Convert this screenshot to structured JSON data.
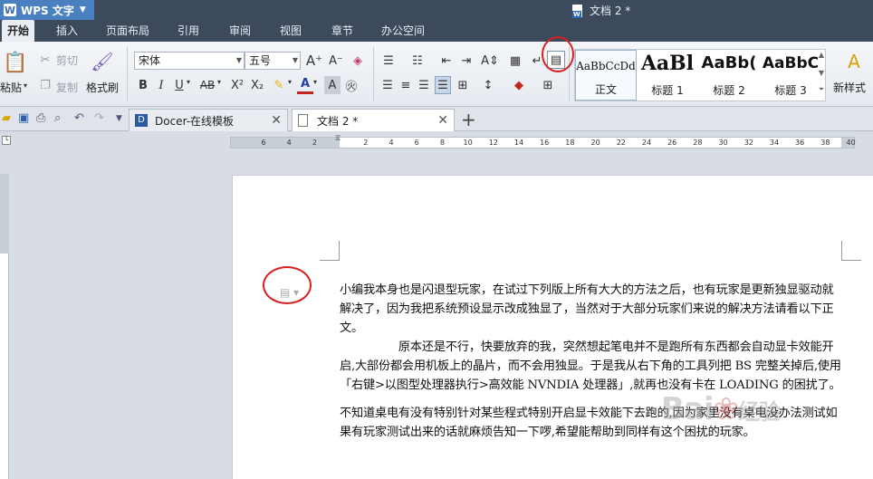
{
  "titlebar": {
    "app_name": "WPS 文字",
    "doc_title": "文档 2 *"
  },
  "menu": {
    "tabs": [
      "开始",
      "插入",
      "页面布局",
      "引用",
      "审阅",
      "视图",
      "章节",
      "办公空间"
    ]
  },
  "ribbon": {
    "paste": "粘贴",
    "cut": "剪切",
    "copy": "复制",
    "format_painter": "格式刷",
    "font_name": "宋体",
    "font_size": "五号",
    "styles": [
      {
        "sample": "AaBbCcDd",
        "name": "正文"
      },
      {
        "sample": "AaBl",
        "name": "标题 1"
      },
      {
        "sample": "AaBb(",
        "name": "标题 2"
      },
      {
        "sample": "AaBbC",
        "name": "标题 3"
      }
    ],
    "new_style": "新样式"
  },
  "doc_tabs": [
    {
      "label": "Docer-在线模板"
    },
    {
      "label": "文档 2 *"
    }
  ],
  "ruler": {
    "numbers": [
      "6",
      "4",
      "2",
      "",
      "2",
      "4",
      "6",
      "8",
      "10",
      "12",
      "14",
      "16",
      "18",
      "20",
      "22",
      "24",
      "26",
      "28",
      "30",
      "32",
      "34",
      "36",
      "38",
      "40"
    ]
  },
  "document": {
    "paragraphs": [
      "小编我本身也是闪退型玩家，在试过下列版上所有大大的方法之后，也有玩家是更新独显驱动就解决了，因为我把系统预设显示改成独显了，当然对于大部分玩家们来说的解决方法请看以下正文。",
      "　　　　　原本还是不行，快要放弃的我，突然想起笔电并不是跑所有东西都会自动显卡效能开启,大部份都会用机板上的晶片，而不会用独显。于是我从右下角的工具列把 BS 完整关掉后,使用「右键>以图型处理器执行>高效能 NVNDIA 处理器」,就再也没有卡在 LOADING 的困扰了。",
      "不知道桌电有没有特别针对某些程式特别开启显卡效能下去跑的,因为家里没有桌电没办法测试如果有玩家测试出来的话就麻烦告知一下啰,希望能帮助到同样有这个困扰的玩家。"
    ]
  },
  "watermark": {
    "text": "Bai",
    "sub": "经验"
  }
}
